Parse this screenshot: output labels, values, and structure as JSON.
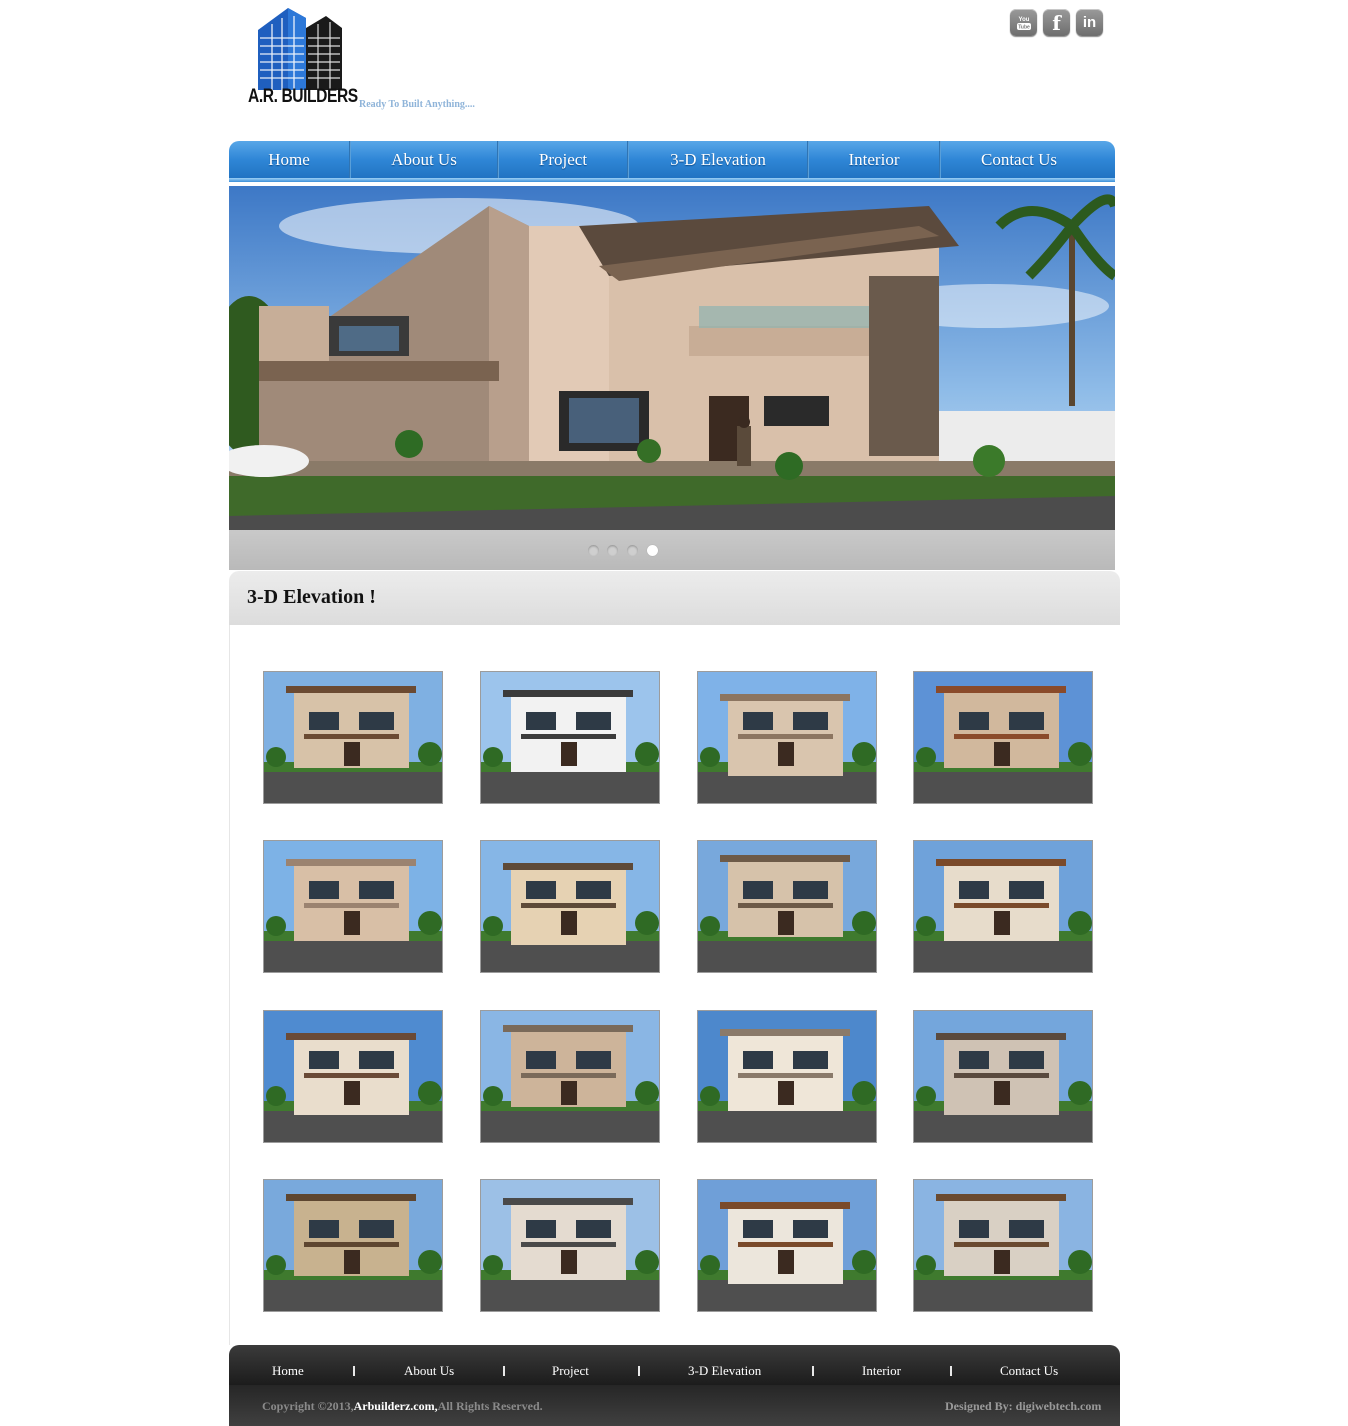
{
  "header": {
    "logo_text": "A.R. BUILDERS",
    "tagline": "Ready To Built Anything....",
    "social": [
      {
        "name": "YouTube",
        "icon": "youtube-icon",
        "glyph": "You Tube"
      },
      {
        "name": "Facebook",
        "icon": "facebook-icon",
        "glyph": "f"
      },
      {
        "name": "LinkedIn",
        "icon": "linkedin-icon",
        "glyph": "in"
      }
    ]
  },
  "nav": {
    "items": [
      "Home",
      "About Us",
      "Project",
      "3-D Elevation",
      "Interior",
      "Contact Us"
    ]
  },
  "slider": {
    "slide_count": 4,
    "active_slide": 4
  },
  "section": {
    "title": "3-D Elevation !"
  },
  "gallery": {
    "rows": 4,
    "columns": 4,
    "count": 16
  },
  "footer": {
    "nav": [
      "Home",
      "About Us",
      "Project",
      "3-D Elevation",
      "Interior",
      "Contact Us"
    ],
    "copyright_prefix": "Copyright ©2013,",
    "copyright_site": "Arbuilderz.com,",
    "copyright_suffix": "All Rights Reserved.",
    "designed_by": "Designed By: digiwebtech.com"
  },
  "colors": {
    "nav_blue": "#2f86d6",
    "footer_dark": "#2a2a2a",
    "tagline": "#8fb4d9"
  }
}
